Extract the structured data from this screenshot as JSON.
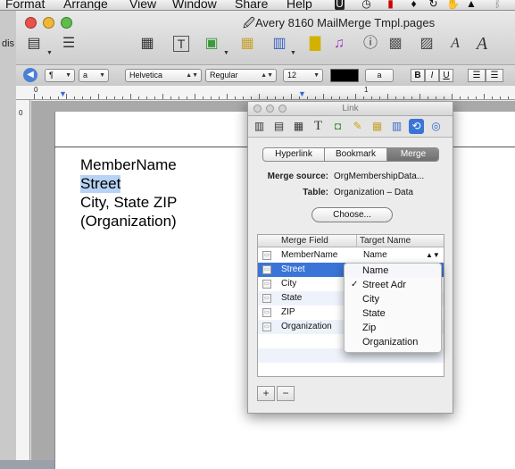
{
  "menubar": {
    "items": [
      "Format",
      "Arrange",
      "View",
      "Window",
      "Share",
      "Help"
    ]
  },
  "window": {
    "title": "Avery 8160 MailMerge Tmpl.pages",
    "bg_window_text": "dis"
  },
  "format_bar": {
    "paragraph_style": "¶",
    "char_style": "a",
    "font": "Helvetica",
    "typeface": "Regular",
    "size": "12",
    "bold": "B",
    "italic": "I",
    "underline": "U",
    "highlight_label": "a"
  },
  "ruler": {
    "numbers": [
      "0",
      "1"
    ],
    "vertical_number": "0"
  },
  "document": {
    "lines": [
      "MemberName",
      "Street",
      "City, State ZIP",
      "(Organization)"
    ]
  },
  "inspector": {
    "title": "Link",
    "tabs": [
      "Hyperlink",
      "Bookmark",
      "Merge"
    ],
    "active_tab": "Merge",
    "merge_source_label": "Merge source:",
    "merge_source_value": "OrgMembershipData...",
    "table_label": "Table:",
    "table_value": "Organization – Data",
    "choose_button": "Choose...",
    "columns": [
      "Merge Field",
      "Target Name"
    ],
    "rows": [
      {
        "field": "MemberName",
        "target": "Name"
      },
      {
        "field": "Street",
        "target": ""
      },
      {
        "field": "City",
        "target": ""
      },
      {
        "field": "State",
        "target": ""
      },
      {
        "field": "ZIP",
        "target": ""
      },
      {
        "field": "Organization",
        "target": ""
      }
    ],
    "add_button": "+",
    "remove_button": "−"
  },
  "dropdown": {
    "items": [
      "Name",
      "Street Adr",
      "City",
      "State",
      "Zip",
      "Organization"
    ],
    "checked": "Street Adr",
    "check_mark": "✓"
  },
  "colors": {
    "selection": "#3b74d7",
    "doc_highlight": "#b6d2f4"
  }
}
